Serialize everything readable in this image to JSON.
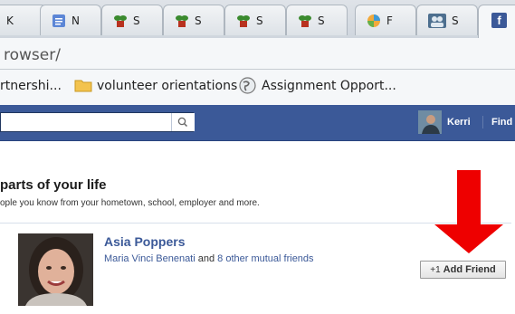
{
  "browser": {
    "tabs": [
      {
        "label": "K",
        "icon": "close-x"
      },
      {
        "label": "N",
        "icon": "document-icon"
      },
      {
        "label": "S",
        "icon": "plant-icon"
      },
      {
        "label": "S",
        "icon": "plant-icon"
      },
      {
        "label": "S",
        "icon": "plant-icon"
      },
      {
        "label": "S",
        "icon": "plant-icon"
      },
      {
        "label": "F",
        "icon": "colorful-icon"
      },
      {
        "label": "S",
        "icon": "group-icon"
      },
      {
        "label": "f",
        "icon": "facebook-icon"
      }
    ],
    "url": "rowser/",
    "bookmarks": [
      {
        "label": "rtnershi...",
        "icon": "none"
      },
      {
        "label": "volunteer orientations",
        "icon": "folder-icon"
      },
      {
        "label": "Assignment Opport...",
        "icon": "globe-icon"
      }
    ]
  },
  "facebook": {
    "nav": {
      "user": "Kerri",
      "find": "Find"
    },
    "section": {
      "heading": "parts of your life",
      "subheading": "ople you know from your hometown, school, employer and more."
    },
    "suggestion": {
      "name": "Asia Poppers",
      "mutual_name": "Maria Vinci Benenati",
      "mutual_and": " and ",
      "mutual_link": "8 other mutual friends",
      "button": "Add Friend"
    },
    "colors": {
      "brand": "#3b5998",
      "arrow": "#ee0000"
    }
  }
}
